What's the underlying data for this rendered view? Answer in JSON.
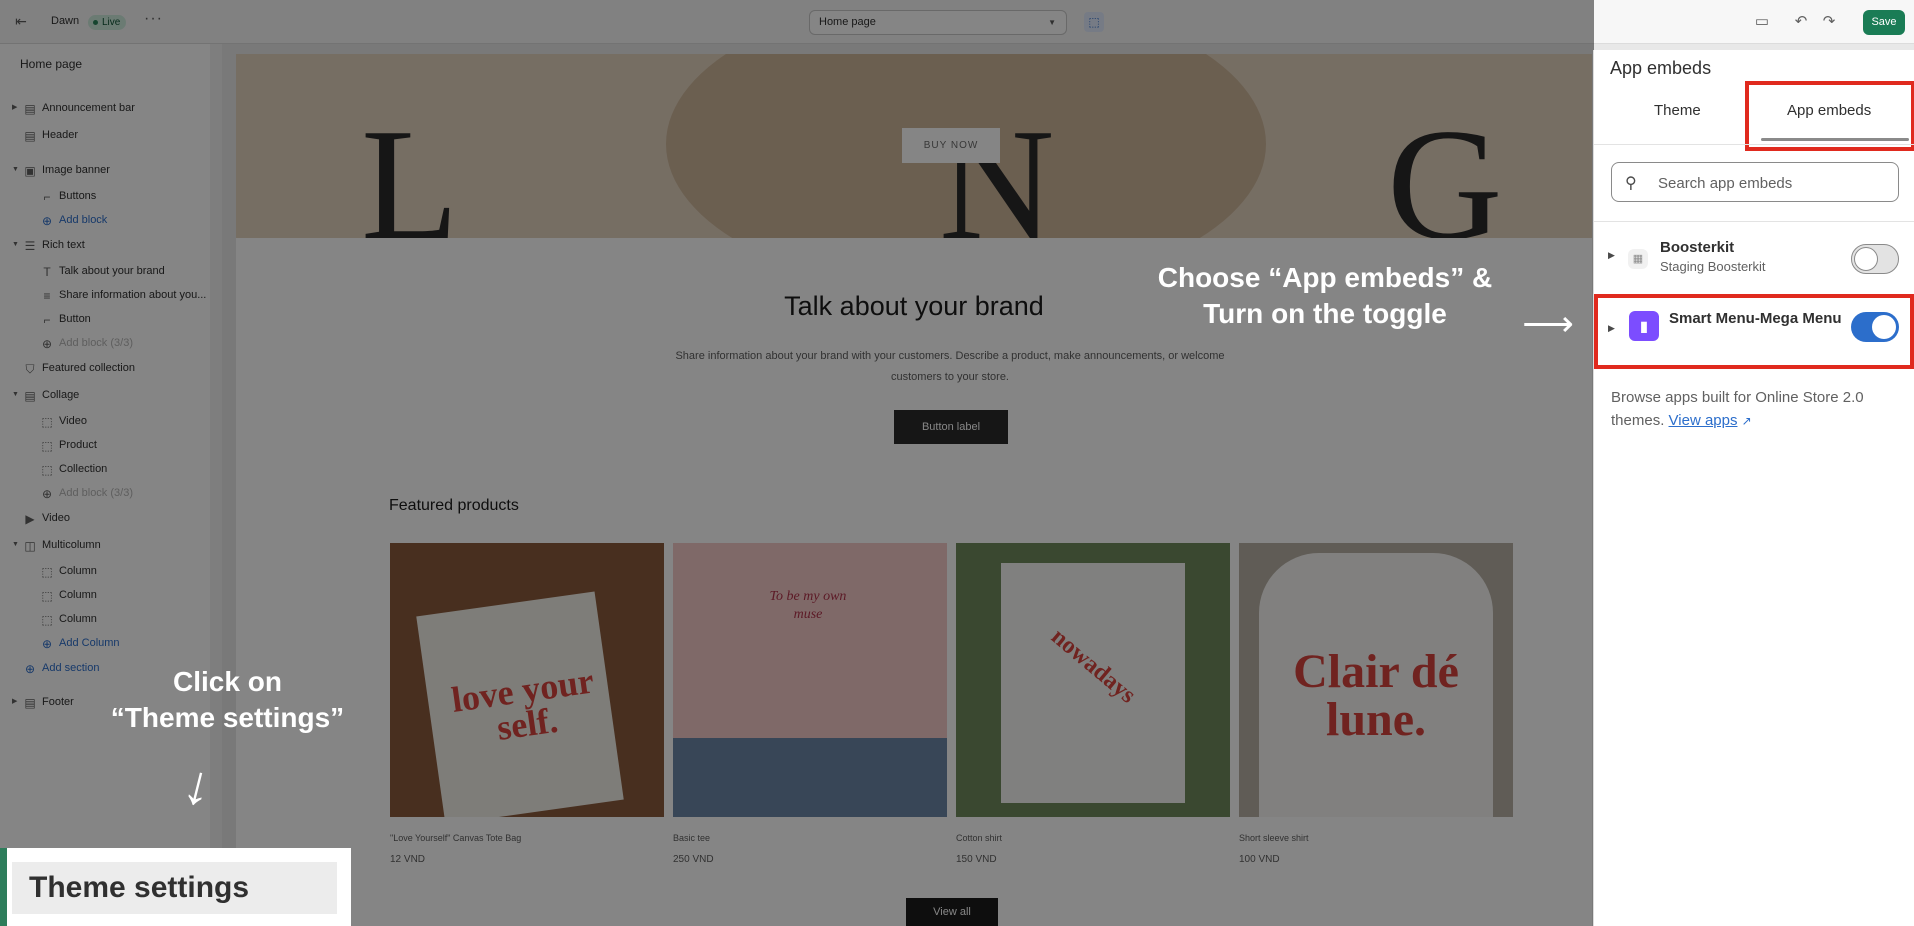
{
  "topbar": {
    "theme_name": "Dawn",
    "status": "Live",
    "more_label": "···",
    "page_select": "Home page",
    "save_label": "Save"
  },
  "sidebar": {
    "heading": "Home page",
    "items": [
      {
        "label": "Announcement bar",
        "icon": "section-icon"
      },
      {
        "label": "Header",
        "icon": "section-icon"
      },
      {
        "label": "Image banner",
        "icon": "image-icon"
      },
      {
        "label": "Buttons",
        "icon": "button-block-icon"
      },
      {
        "label": "Add block",
        "icon": "add-icon"
      },
      {
        "label": "Rich text",
        "icon": "text-section-icon"
      },
      {
        "label": "Talk about your brand",
        "icon": "heading-icon"
      },
      {
        "label": "Share information about you...",
        "icon": "paragraph-icon"
      },
      {
        "label": "Button",
        "icon": "button-block-icon"
      },
      {
        "label": "Add block (3/3)",
        "icon": "add-icon"
      },
      {
        "label": "Featured collection",
        "icon": "collection-icon"
      },
      {
        "label": "Collage",
        "icon": "section-icon"
      },
      {
        "label": "Video",
        "icon": "block-icon"
      },
      {
        "label": "Product",
        "icon": "block-icon"
      },
      {
        "label": "Collection",
        "icon": "block-icon"
      },
      {
        "label": "Add block (3/3)",
        "icon": "add-icon"
      },
      {
        "label": "Video",
        "icon": "play-icon"
      },
      {
        "label": "Multicolumn",
        "icon": "columns-icon"
      },
      {
        "label": "Column",
        "icon": "block-icon"
      },
      {
        "label": "Column",
        "icon": "block-icon"
      },
      {
        "label": "Column",
        "icon": "block-icon"
      },
      {
        "label": "Add Column",
        "icon": "add-icon"
      },
      {
        "label": "Add section",
        "icon": "add-icon"
      },
      {
        "label": "Footer",
        "icon": "section-icon"
      }
    ],
    "theme_settings": "Theme settings"
  },
  "preview": {
    "hero_letters": [
      "L",
      "N",
      "G"
    ],
    "buy_now": "BUY NOW",
    "rich_title": "Talk about your brand",
    "rich_body": "Share information about your brand with your customers. Describe a product, make announcements, or welcome customers to your store.",
    "rich_button": "Button label",
    "featured_title": "Featured products",
    "products": [
      {
        "name": "\"Love Yourself\" Canvas Tote Bag",
        "price": "12 VND",
        "art": "love your self."
      },
      {
        "name": "Basic tee",
        "price": "250 VND",
        "art": "To be my own muse"
      },
      {
        "name": "Cotton shirt",
        "price": "150 VND",
        "art": "nowadays"
      },
      {
        "name": "Short sleeve shirt",
        "price": "100 VND",
        "art": "Clair dé lune."
      }
    ],
    "view_all": "View all"
  },
  "annotations": {
    "left_line1": "Click on",
    "left_line2": "“Theme settings”",
    "right_line1": "Choose “App embeds” &",
    "right_line2": "Turn on the toggle",
    "arrow_down": "↓",
    "arrow_right": "⟶"
  },
  "panel": {
    "title": "App embeds",
    "tabs": [
      "Theme",
      "App embeds"
    ],
    "search_placeholder": "Search app embeds",
    "embeds": [
      {
        "name": "Boosterkit",
        "subtitle": "Staging Boosterkit",
        "enabled": false
      },
      {
        "name": "Smart Menu-Mega Menu",
        "subtitle": "",
        "enabled": true
      }
    ],
    "browse_text": "Browse apps built for Online Store 2.0 themes.",
    "view_apps": "View apps"
  },
  "colors": {
    "accent": "#2c6ecb",
    "save": "#1a7c55",
    "highlight": "#e02a1e",
    "toggle_on": "#2c6ecb"
  }
}
